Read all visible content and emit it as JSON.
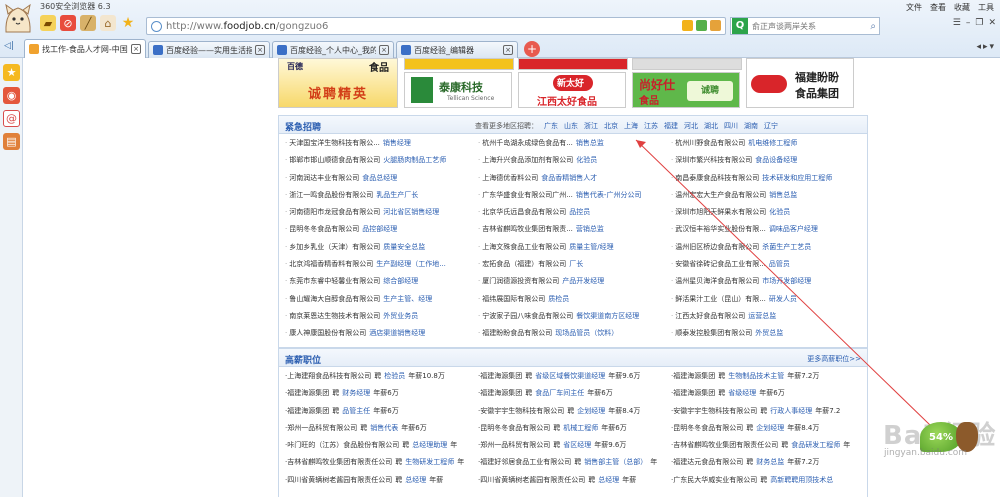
{
  "browser": {
    "title": "360安全浏览器 6.3",
    "address_url_prefix": "http://www.",
    "address_url_domain": "foodjob.cn",
    "address_url_suffix": "/gongzuo6",
    "search_placeholder": "俞正声谈两岸关系",
    "menu": [
      "文件",
      "查看",
      "收藏",
      "工具"
    ],
    "tabs": [
      {
        "title": "找工作-食品人才网-中国食品...",
        "active": true,
        "icon_color": "#f0a22e"
      },
      {
        "title": "百度经验——实用生活指南",
        "active": false,
        "icon_color": "#3b6fc6"
      },
      {
        "title": "百度经验_个人中心_我的经验",
        "active": false,
        "icon_color": "#3b6fc6"
      },
      {
        "title": "百度经验_编辑器",
        "active": false,
        "icon_color": "#3b6fc6"
      }
    ],
    "icons": [
      "ghost-icon",
      "truck-icon",
      "block-icon",
      "broom-icon",
      "house-icon",
      "star-icon"
    ]
  },
  "sidebar": {
    "icons": [
      {
        "name": "favorites-star-icon",
        "glyph": "★",
        "color": "#f5b921"
      },
      {
        "name": "weibo-icon",
        "glyph": "◉",
        "color": "#e4573c"
      },
      {
        "name": "mail-icon",
        "glyph": "@",
        "color": "#d94c4c"
      },
      {
        "name": "app-icon",
        "glyph": "▤",
        "color": "#e0803a"
      }
    ]
  },
  "banners": {
    "chengpin_top_left": "食品",
    "chengpin": "诚聘精英",
    "taikang": "泰康科技",
    "taikang_sub": "Tellican Science",
    "xintaihao": "新太好",
    "xintaihao_sub": "江西太好食品",
    "shikang": "尚好仕",
    "shikang_sub": "食品",
    "fujian": "福建盼盼",
    "fujian_sub": "食品集团"
  },
  "urgent": {
    "title": "紧急招聘",
    "region_label": "查看更多地区招聘：",
    "regions": [
      "广东",
      "山东",
      "浙江",
      "北京",
      "上海",
      "江苏",
      "福建",
      "河北",
      "湖北",
      "四川",
      "湖南",
      "辽宁"
    ],
    "jobs": [
      {
        "company": "天津国宝洋生物科技有限公...",
        "position": "销售经理"
      },
      {
        "company": "杭州千岛湖永成绿色食品有...",
        "position": "销售总监"
      },
      {
        "company": "杭州川野食品有限公司",
        "position": "机电维修工程师"
      },
      {
        "company": "邯郸市邯山顺德食品有限公司",
        "position": "火腿肠肉制品工艺师"
      },
      {
        "company": "上海升兴食品添加剂有限公司",
        "position": "化验员"
      },
      {
        "company": "深圳市繁兴科技有限公司",
        "position": "食品设备经理"
      },
      {
        "company": "河南润达丰业有限公司",
        "position": "食品总经理"
      },
      {
        "company": "上海德优香料公司",
        "position": "食品香精销售人才"
      },
      {
        "company": "南昌泰康食品科技有限公司",
        "position": "技术研发和应用工程师"
      },
      {
        "company": "浙江一鸣食品股份有限公司",
        "position": "乳品生产厂长"
      },
      {
        "company": "广东华盛食业有限公司广州...",
        "position": "销售代表-广州分公司"
      },
      {
        "company": "温州宏宏大生产食品有限公司",
        "position": "销售总监"
      },
      {
        "company": "河南德阳市龙冠食品有限公司",
        "position": "河北省区销售经理"
      },
      {
        "company": "北京华氏远昌食品有限公司",
        "position": "品控员"
      },
      {
        "company": "深圳市旭阳天鲜果水有限公司",
        "position": "化验员"
      },
      {
        "company": "昆明冬冬食品有限公司",
        "position": "品控部经理"
      },
      {
        "company": "吉林省麒鸣牧业集团有限责...",
        "position": "营销总监"
      },
      {
        "company": "武汉恒丰裕华实业股份有限...",
        "position": "调味品客户经理"
      },
      {
        "company": "乡加乡乳业（天津）有限公司",
        "position": "质量安全总监"
      },
      {
        "company": "上海文殊食品工业有限公司",
        "position": "质量主管/经理"
      },
      {
        "company": "温州旧区桥边食品有限公司",
        "position": "杀菌生产工艺员"
      },
      {
        "company": "北京鸿福香精香料有限公司",
        "position": "生产副经理（工作地..."
      },
      {
        "company": "宏拓食品（福建）有限公司",
        "position": "厂长"
      },
      {
        "company": "安徽省徐砖记食品工业有限...",
        "position": "品管员"
      },
      {
        "company": "东莞市东睿中轻馨业有限公司",
        "position": "综合部经理"
      },
      {
        "company": "厦门润德源投资有限公司",
        "position": "产品开发经理"
      },
      {
        "company": "温州星贝海洋食品有限公司",
        "position": "市场开发部经理"
      },
      {
        "company": "鲁山耀海大自醇食品有限公司",
        "position": "生产主管、经理"
      },
      {
        "company": "福纬展国际有限公司",
        "position": "质检员"
      },
      {
        "company": "鲜活果汁工业（昆山）有限...",
        "position": "研发人员"
      },
      {
        "company": "南京莱恩达生物技术有限公司",
        "position": "外贸业务员"
      },
      {
        "company": "宁波家子园八味食品有限公司",
        "position": "餐饮渠道南方区经理"
      },
      {
        "company": "江西太好食品有限公司",
        "position": "运营总监"
      },
      {
        "company": "康人神康国股份有限公司",
        "position": "酒店渠道销售经理"
      },
      {
        "company": "福建盼盼食品有限公司",
        "position": "现场品管员（饮料）"
      },
      {
        "company": "顺泰发控股集团有限公司",
        "position": "外贸总监"
      }
    ]
  },
  "highpay": {
    "title": "高薪职位",
    "more": "更多高薪职位>>",
    "hire_word": "聘",
    "jobs": [
      {
        "company": "上海建翔食品科技有限公司",
        "position": "检验员",
        "salary": "年薪10.8万"
      },
      {
        "company": "福建海源集团",
        "position": "省级区域餐饮渠道经理",
        "salary": "年薪9.6万"
      },
      {
        "company": "福建海源集团",
        "position": "生物制品技术主管",
        "salary": "年薪7.2万"
      },
      {
        "company": "福建海源集团",
        "position": "财务经理",
        "salary": "年薪6万"
      },
      {
        "company": "福建海源集团",
        "position": "食品厂车间主任",
        "salary": "年薪6万"
      },
      {
        "company": "福建海源集团",
        "position": "省级经理",
        "salary": "年薪6万"
      },
      {
        "company": "福建海源集团",
        "position": "品管主任",
        "salary": "年薪6万"
      },
      {
        "company": "安徽宇宇生物科技有限公司",
        "position": "企划经理",
        "salary": "年薪8.4万"
      },
      {
        "company": "安徽宇宇生物科技有限公司",
        "position": "行政人事经理",
        "salary": "年薪7.2"
      },
      {
        "company": "郑州一品科贸有限公司",
        "position": "销售代表",
        "salary": "年薪6万"
      },
      {
        "company": "昆明冬冬食品有限公司",
        "position": "机械工程师",
        "salary": "年薪6万"
      },
      {
        "company": "昆明冬冬食品有限公司",
        "position": "企划经理",
        "salary": "年薪8.4万"
      },
      {
        "company": "咔门旺的（江苏）食品股份有限公司",
        "position": "总经理助理",
        "salary": "年"
      },
      {
        "company": "郑州一品科贸有限公司",
        "position": "省区经理",
        "salary": "年薪9.6万"
      },
      {
        "company": "吉林省麒鸣牧业集团有限责任公司",
        "position": "食品研发工程师",
        "salary": "年"
      },
      {
        "company": "吉林省麒鸣牧业集团有限责任公司",
        "position": "生物研发工程师",
        "salary": "年"
      },
      {
        "company": "福建好邻居食品工业有限公司",
        "position": "销售部主管（总部）",
        "salary": "年"
      },
      {
        "company": "福建达元食品有限公司",
        "position": "财务总监",
        "salary": "年薪7.2万"
      },
      {
        "company": "四川省黄辆树老酱园有限责任公司",
        "position": "总经理",
        "salary": "年薪"
      },
      {
        "company": "四川省黄辆树老酱园有限责任公司",
        "position": "总经理",
        "salary": "年薪"
      },
      {
        "company": "广东民大华威实业有限公司",
        "position": "高新聘聘用顶技术总",
        "salary": ""
      }
    ]
  },
  "watermark": {
    "brand": "Bai 经验",
    "leaf_text": "54%",
    "url": "jingyan.baidu.com"
  }
}
